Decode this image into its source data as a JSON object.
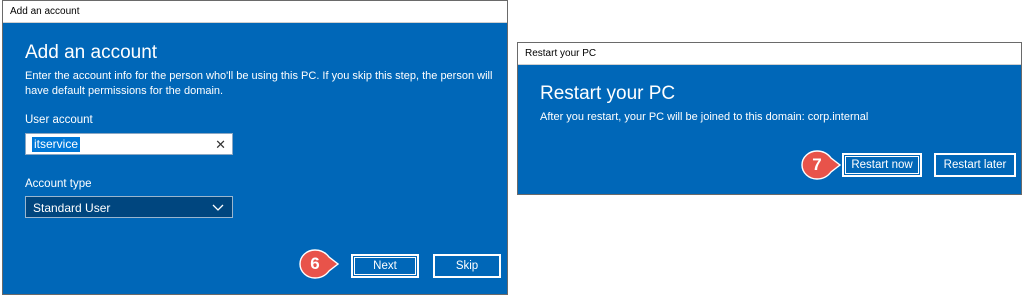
{
  "dialog1": {
    "title": "Add an account",
    "heading": "Add an account",
    "description": "Enter the account info for the person who'll be using this PC. If you skip this step, the person will have default permissions for the domain.",
    "user_account_label": "User account",
    "user_account_value": "itservice",
    "account_type_label": "Account type",
    "account_type_value": "Standard User",
    "next_label": "Next",
    "skip_label": "Skip",
    "step_number": "6"
  },
  "dialog2": {
    "title": "Restart your PC",
    "heading": "Restart your PC",
    "description": "After you restart, your PC will be joined to this domain: corp.internal",
    "restart_now_label": "Restart now",
    "restart_later_label": "Restart later",
    "step_number": "7"
  },
  "icons": {
    "clear": "close-icon",
    "dropdown": "chevron-down-icon"
  },
  "colors": {
    "dialog_background": "#0067b8",
    "selection": "#0078d7",
    "step_badge": "#e8534a"
  }
}
